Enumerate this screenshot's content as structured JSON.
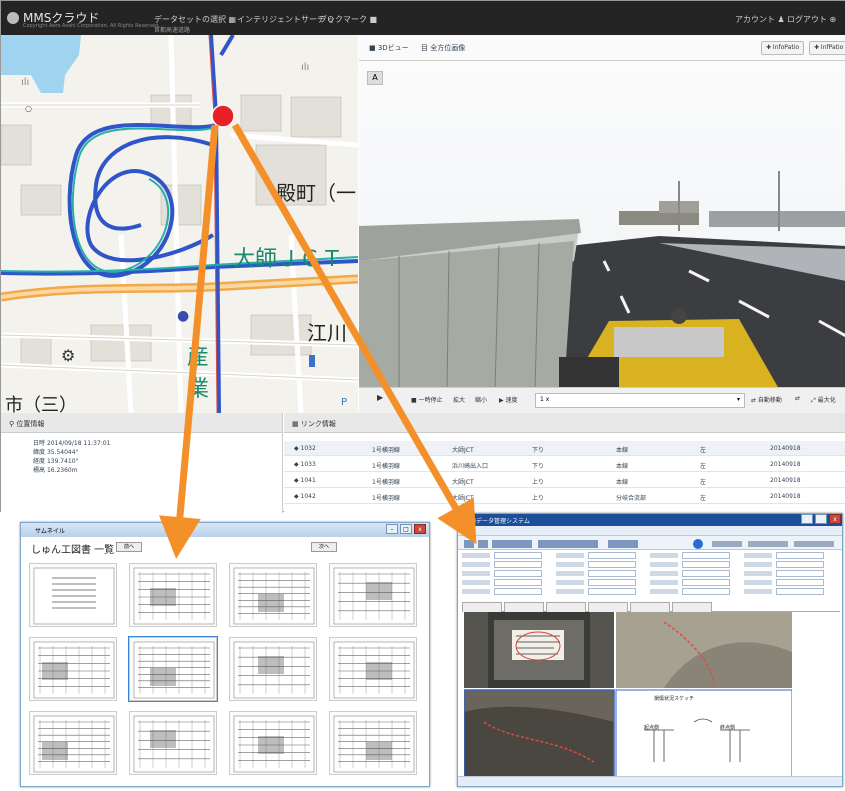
{
  "app": {
    "logo_text": "MMSクラウド",
    "copyright": "Copyright Aero Asahi Corporation. All Rights Reserved.",
    "nav": [
      {
        "label": "データセットの選択 ▦",
        "icon": "dataset-icon"
      },
      {
        "label": "インテリジェントサーチ Q",
        "icon": "search-icon"
      },
      {
        "label": "ブックマーク ■",
        "icon": "bookmark-icon"
      },
      {
        "label": "アカウント ♟",
        "icon": "user-icon"
      },
      {
        "label": "ログアウト ⊕",
        "icon": "logout-icon"
      }
    ],
    "nav_sub": "首都高速道路",
    "map_labels": {
      "label_1": "殿町（一",
      "label_2": "大師ＪＣＴ",
      "label_3": "江川",
      "label_4": "産",
      "label_5": "業",
      "label_6": "市（三）"
    }
  },
  "viewer": {
    "tabs": [
      {
        "label": "■ 3Dビュー"
      },
      {
        "label": "目 全方位画像"
      }
    ],
    "buttons": [
      {
        "label": "✚ InfoPatio"
      },
      {
        "label": "✚ InfPatio"
      }
    ],
    "a_label": "A",
    "controls": {
      "play": "▶",
      "pause": "■ 一時停止",
      "zoom_in": "拡大",
      "zoom_out": "縮小",
      "speed": "▶ 速度",
      "speed_value": "1 x",
      "auto_move": "⇄ 自動移動",
      "mode_icon": "⇄",
      "maximize": "⤢ 最大化"
    }
  },
  "position": {
    "header": "位置情報",
    "rows": [
      {
        "label": "日時",
        "value": "2014/09/18 11:37:01"
      },
      {
        "label": "緯度",
        "value": "35.54044°"
      },
      {
        "label": "経度",
        "value": "139.7410°"
      },
      {
        "label": "標高",
        "value": "16.2360m"
      }
    ]
  },
  "links": {
    "header": "リンク情報",
    "rows": [
      {
        "id": "◆ 1032",
        "route": "1号横羽線",
        "point": "大師JCT",
        "dir": "下り",
        "kind": "本線",
        "side": "左",
        "date": "20140918"
      },
      {
        "id": "◆ 1033",
        "route": "1号横羽線",
        "point": "浜川崎出入口",
        "dir": "下り",
        "kind": "本線",
        "side": "左",
        "date": "20140918"
      },
      {
        "id": "◆ 1041",
        "route": "1号横羽線",
        "point": "大師JCT",
        "dir": "上り",
        "kind": "本線",
        "side": "左",
        "date": "20140918"
      },
      {
        "id": "◆ 1042",
        "route": "1号横羽線",
        "point": "大師JCT",
        "dir": "上り",
        "kind": "分岐合流部",
        "side": "左",
        "date": "20140918"
      }
    ]
  },
  "drawing_window": {
    "title": "サムネイル",
    "heading": "しゅん工図書 一覧",
    "btn_left": "前へ",
    "btn_right": "次へ",
    "thumbnail_count": 12,
    "selected_index": 5
  },
  "inspection_window": {
    "title": "点検データ管理システム",
    "photo_caption": "損傷状況スケッチ",
    "sketch_labels": {
      "left": "起点側",
      "right": "終点側"
    }
  },
  "colors": {
    "marker": "#e8202a",
    "arrow": "#f4902a",
    "topbar": "#242424",
    "route": "#2f55c8"
  }
}
